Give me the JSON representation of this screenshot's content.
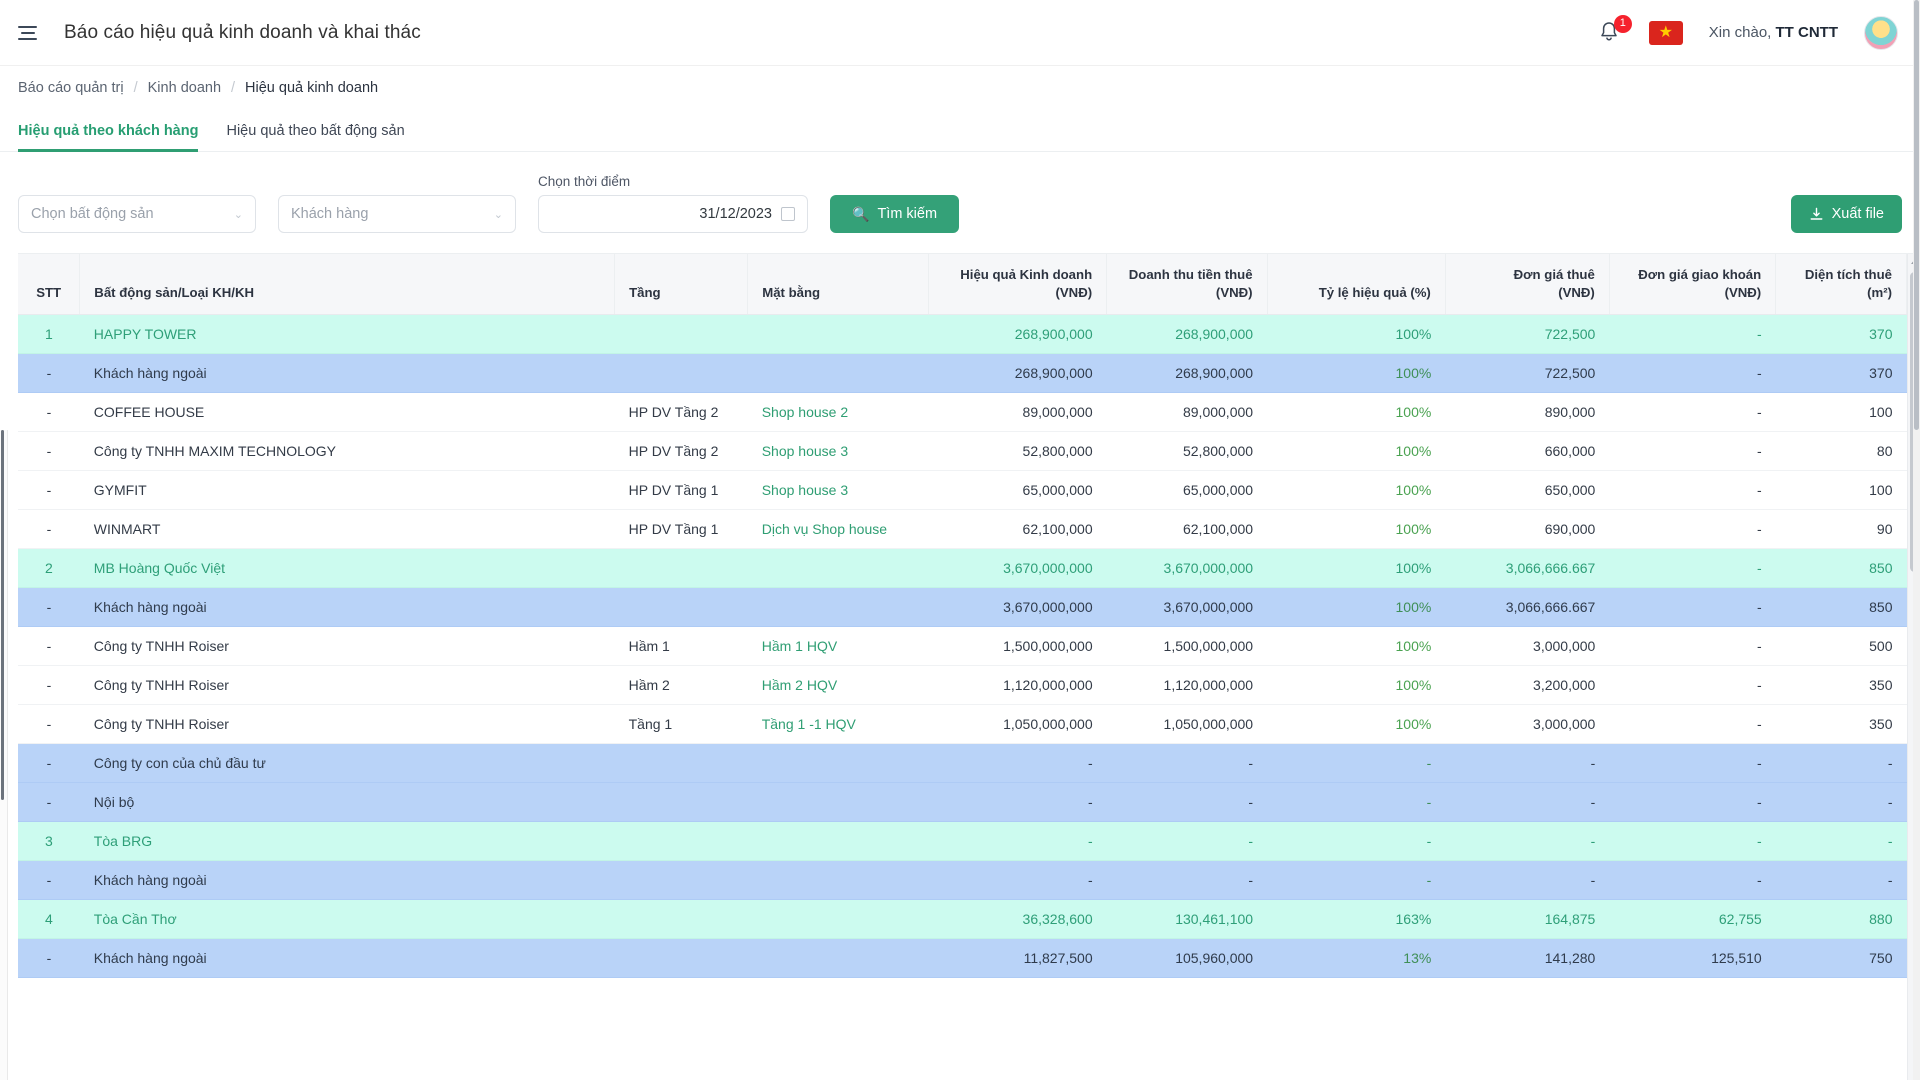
{
  "topbar": {
    "menu_icon": "hamburger-icon",
    "title": "Báo cáo hiệu quả kinh doanh và khai thác",
    "notification_count": "1",
    "flag": "★",
    "greeting_prefix": "Xin chào, ",
    "user_name": "TT CNTT"
  },
  "breadcrumb": {
    "items": [
      {
        "label": "Báo cáo quản trị"
      },
      {
        "label": "Kinh doanh"
      },
      {
        "label": "Hiệu quả kinh doanh"
      }
    ],
    "separator": "/"
  },
  "tabs": [
    {
      "label": "Hiệu quả theo khách hàng",
      "active": true
    },
    {
      "label": "Hiệu quả theo bất động sản",
      "active": false
    }
  ],
  "filters": {
    "property_select": {
      "placeholder": "Chọn bất động sản",
      "caret": "⌄"
    },
    "customer_select": {
      "placeholder": "Khách hàng",
      "caret": "⌄"
    },
    "date": {
      "label": "Chọn thời điểm",
      "value": "31/12/2023"
    },
    "search_button": {
      "label": "Tìm kiếm",
      "icon": "search-icon"
    },
    "export_button": {
      "label": "Xuất file",
      "icon": "download-icon"
    }
  },
  "colors": {
    "accent_green": "#2f9e73",
    "group_row": "#ccfbef",
    "subgroup_row": "#b9d3f8",
    "badge_red": "#f5222d",
    "flag_red": "#da251d",
    "flag_star": "#ffcd00"
  },
  "table": {
    "columns": [
      {
        "key": "stt",
        "label": "STT"
      },
      {
        "key": "name",
        "label": "Bất động sản/Loại KH/KH"
      },
      {
        "key": "tang",
        "label": "Tầng"
      },
      {
        "key": "mb",
        "label": "Mặt bằng"
      },
      {
        "key": "hq",
        "label": "Hiệu quả Kinh doanh\n(VNĐ)"
      },
      {
        "key": "dt",
        "label": "Doanh thu tiền thuê\n(VNĐ)"
      },
      {
        "key": "ty",
        "label": "Tỷ lệ hiệu quả (%)"
      },
      {
        "key": "dg",
        "label": "Đơn giá thuê\n(VNĐ)"
      },
      {
        "key": "dgk",
        "label": "Đơn giá giao khoán\n(VNĐ)"
      },
      {
        "key": "dtt",
        "label": "Diện tích thuê\n(m²)"
      }
    ],
    "rows": [
      {
        "type": "group",
        "stt": "1",
        "name": "HAPPY TOWER",
        "tang": "",
        "mb": "",
        "hq": "268,900,000",
        "dt": "268,900,000",
        "ty": "100%",
        "dg": "722,500",
        "dgk": "-",
        "dtt": "370"
      },
      {
        "type": "subgroup",
        "stt": "-",
        "name": "Khách hàng ngoài",
        "tang": "",
        "mb": "",
        "hq": "268,900,000",
        "dt": "268,900,000",
        "ty": "100%",
        "dg": "722,500",
        "dgk": "-",
        "dtt": "370"
      },
      {
        "type": "leaf",
        "stt": "-",
        "name": "COFFEE HOUSE",
        "tang": "HP DV Tầng 2",
        "mb": "Shop house 2",
        "hq": "89,000,000",
        "dt": "89,000,000",
        "ty": "100%",
        "dg": "890,000",
        "dgk": "-",
        "dtt": "100"
      },
      {
        "type": "leaf",
        "stt": "-",
        "name": "Công ty TNHH MAXIM TECHNOLOGY",
        "tang": "HP DV Tầng 2",
        "mb": "Shop house 3",
        "hq": "52,800,000",
        "dt": "52,800,000",
        "ty": "100%",
        "dg": "660,000",
        "dgk": "-",
        "dtt": "80"
      },
      {
        "type": "leaf",
        "stt": "-",
        "name": "GYMFIT",
        "tang": "HP DV Tầng 1",
        "mb": "Shop house 3",
        "hq": "65,000,000",
        "dt": "65,000,000",
        "ty": "100%",
        "dg": "650,000",
        "dgk": "-",
        "dtt": "100"
      },
      {
        "type": "leaf",
        "stt": "-",
        "name": "WINMART",
        "tang": "HP DV Tầng 1",
        "mb": "Dịch vụ Shop house",
        "hq": "62,100,000",
        "dt": "62,100,000",
        "ty": "100%",
        "dg": "690,000",
        "dgk": "-",
        "dtt": "90"
      },
      {
        "type": "group",
        "stt": "2",
        "name": "MB Hoàng Quốc Việt",
        "tang": "",
        "mb": "",
        "hq": "3,670,000,000",
        "dt": "3,670,000,000",
        "ty": "100%",
        "dg": "3,066,666.667",
        "dgk": "-",
        "dtt": "850"
      },
      {
        "type": "subgroup",
        "stt": "-",
        "name": "Khách hàng ngoài",
        "tang": "",
        "mb": "",
        "hq": "3,670,000,000",
        "dt": "3,670,000,000",
        "ty": "100%",
        "dg": "3,066,666.667",
        "dgk": "-",
        "dtt": "850"
      },
      {
        "type": "leaf",
        "stt": "-",
        "name": "Công ty TNHH Roiser",
        "tang": "Hầm 1",
        "mb": "Hầm 1 HQV",
        "hq": "1,500,000,000",
        "dt": "1,500,000,000",
        "ty": "100%",
        "dg": "3,000,000",
        "dgk": "-",
        "dtt": "500"
      },
      {
        "type": "leaf",
        "stt": "-",
        "name": "Công ty TNHH Roiser",
        "tang": "Hầm 2",
        "mb": "Hầm 2 HQV",
        "hq": "1,120,000,000",
        "dt": "1,120,000,000",
        "ty": "100%",
        "dg": "3,200,000",
        "dgk": "-",
        "dtt": "350"
      },
      {
        "type": "leaf",
        "stt": "-",
        "name": "Công ty TNHH Roiser",
        "tang": "Tầng 1",
        "mb": "Tầng 1 -1 HQV",
        "hq": "1,050,000,000",
        "dt": "1,050,000,000",
        "ty": "100%",
        "dg": "3,000,000",
        "dgk": "-",
        "dtt": "350"
      },
      {
        "type": "subgroup",
        "stt": "-",
        "name": "Công ty con của chủ đầu tư",
        "tang": "",
        "mb": "",
        "hq": "-",
        "dt": "-",
        "ty": "-",
        "dg": "-",
        "dgk": "-",
        "dtt": "-"
      },
      {
        "type": "subgroup",
        "stt": "-",
        "name": "Nội bộ",
        "tang": "",
        "mb": "",
        "hq": "-",
        "dt": "-",
        "ty": "-",
        "dg": "-",
        "dgk": "-",
        "dtt": "-"
      },
      {
        "type": "group",
        "stt": "3",
        "name": "Tòa BRG",
        "tang": "",
        "mb": "",
        "hq": "-",
        "dt": "-",
        "ty": "-",
        "dg": "-",
        "dgk": "-",
        "dtt": "-"
      },
      {
        "type": "subgroup",
        "stt": "-",
        "name": "Khách hàng ngoài",
        "tang": "",
        "mb": "",
        "hq": "-",
        "dt": "-",
        "ty": "-",
        "dg": "-",
        "dgk": "-",
        "dtt": "-"
      },
      {
        "type": "group",
        "stt": "4",
        "name": "Tòa Cần Thơ",
        "tang": "",
        "mb": "",
        "hq": "36,328,600",
        "dt": "130,461,100",
        "ty": "163%",
        "dg": "164,875",
        "dgk": "62,755",
        "dtt": "880"
      },
      {
        "type": "subgroup",
        "stt": "-",
        "name": "Khách hàng ngoài",
        "tang": "",
        "mb": "",
        "hq": "11,827,500",
        "dt": "105,960,000",
        "ty": "13%",
        "dg": "141,280",
        "dgk": "125,510",
        "dtt": "750"
      }
    ]
  }
}
